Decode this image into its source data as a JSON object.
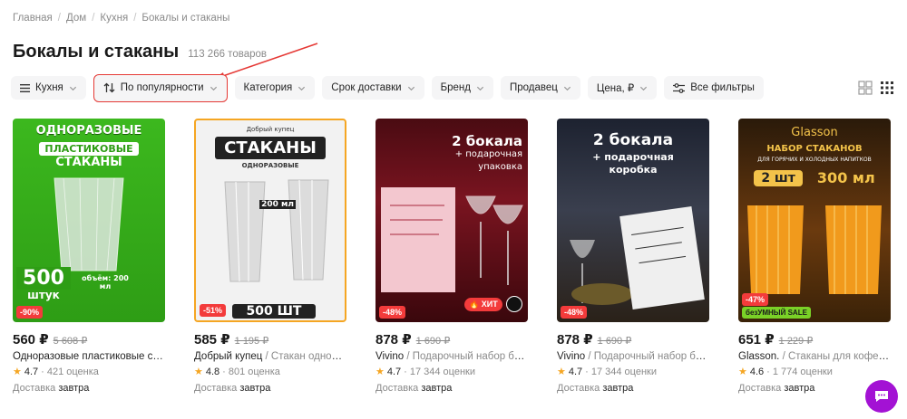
{
  "breadcrumb": [
    "Главная",
    "Дом",
    "Кухня",
    "Бокалы и стаканы"
  ],
  "page": {
    "title": "Бокалы и стаканы",
    "count": "113 266 товаров"
  },
  "filters": {
    "kitchen": "Кухня",
    "sort": "По популярности",
    "category": "Категория",
    "delivery": "Срок доставки",
    "brand": "Бренд",
    "seller": "Продавец",
    "price": "Цена, ₽",
    "all": "Все фильтры"
  },
  "products": [
    {
      "price": "560 ₽",
      "old_price": "5 608 ₽",
      "discount": "-90%",
      "brand": "Одноразовые пластиковые стака…",
      "desc": "",
      "rating": "4.7",
      "reviews": "421 оценка",
      "delivery_label": "Доставка",
      "delivery_when": "завтра",
      "art": {
        "l1": "ОДНОРАЗОВЫЕ",
        "l2": "ПЛАСТИКОВЫЕ",
        "l3": "СТАКАНЫ",
        "big": "500",
        "unit": "штук",
        "vol": "объём: 200 мл"
      }
    },
    {
      "price": "585 ₽",
      "old_price": "1 195 ₽",
      "discount": "-51%",
      "brand": "Добрый купец",
      "desc": " / Стакан одноразо…",
      "rating": "4.8",
      "reviews": "801 оценка",
      "delivery_label": "Доставка",
      "delivery_when": "завтра",
      "art": {
        "top": "Добрый купец",
        "big": "СТАКАНЫ",
        "sub": "ОДНОРАЗОВЫЕ",
        "ml": "200 мл",
        "pcs": "500 ШТ"
      }
    },
    {
      "price": "878 ₽",
      "old_price": "1 690 ₽",
      "discount": "-48%",
      "brand": "Vivino",
      "desc": " / Подарочный набор бокал…",
      "rating": "4.7",
      "reviews": "17 344 оценки",
      "delivery_label": "Доставка",
      "delivery_when": "завтра",
      "art": {
        "l1": "2 бокала",
        "l2": "+ подарочная",
        "l3": "упаковка",
        "hit": "ХИТ"
      }
    },
    {
      "price": "878 ₽",
      "old_price": "1 690 ₽",
      "discount": "-48%",
      "brand": "Vivino",
      "desc": " / Подарочный набор бокал…",
      "rating": "4.7",
      "reviews": "17 344 оценки",
      "delivery_label": "Доставка",
      "delivery_when": "завтра",
      "art": {
        "l1": "2 бокала",
        "l2": "+ подарочная",
        "l3": "коробка"
      }
    },
    {
      "price": "651 ₽",
      "old_price": "1 229 ₽",
      "discount": "-47%",
      "brand": "Glasson.",
      "desc": " / Стаканы для кофе сока …",
      "rating": "4.6",
      "reviews": "1 774 оценки",
      "delivery_label": "Доставка",
      "delivery_when": "завтра",
      "art": {
        "logo": "Glasson",
        "l1": "НАБОР СТАКАНОВ",
        "l2": "ДЛЯ ГОРЯЧИХ И ХОЛОДНЫХ НАПИТКОВ",
        "pcs": "2 шт",
        "ml": "300 мл",
        "promo": "безУМНЫЙ SALE"
      }
    }
  ],
  "colors": {
    "accent_red": "#e53935",
    "discount": "#f33b3b",
    "chat": "#a312d4",
    "star": "#f5a623"
  }
}
